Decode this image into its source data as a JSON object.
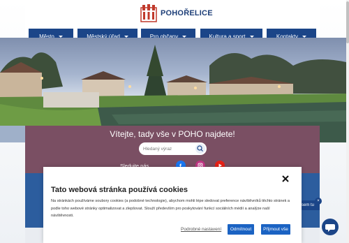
{
  "header": {
    "site_name": "POHOŘELICE"
  },
  "nav": {
    "items": [
      {
        "label": "Město"
      },
      {
        "label": "Městský úřad"
      },
      {
        "label": "Pro občany"
      },
      {
        "label": "Kultura a sport"
      },
      {
        "label": "Kontakty"
      }
    ]
  },
  "hero": {
    "welcome": "Vítejte, tady vše v POHO najdete!",
    "search_placeholder": "Hledaný výraz",
    "follow_label": "Sledujte nás"
  },
  "chat": {
    "bubble_text": "sem tu",
    "close_symbol": "×"
  },
  "cookie_banner": {
    "title": "Tato webová stránka používá cookies",
    "text": "Na stránkách používáme soubory cookies (a podobné technologie), abychom mohli lépe sledovat preference návštěvníků těchto stránek a podle toho webové stránky optimalizovat a zlepšovat. Slouží především pro poskytování funkcí sociálních médií a analýze naší návštěvnosti.",
    "preferences_link": "Podrobné nastavení",
    "deny_label": "Odmítnout",
    "accept_label": "Přijmout vše"
  },
  "colors": {
    "nav_blue": "#1b4588",
    "band_mauve": "#7a4f63",
    "button_blue": "#1b63c3",
    "facebook": "#1877f2",
    "instagram": "#c13584",
    "youtube": "#e62117"
  },
  "icons": [
    "logo-mark",
    "search-icon",
    "facebook-icon",
    "instagram-icon",
    "youtube-icon",
    "close-icon",
    "chat-icon"
  ]
}
